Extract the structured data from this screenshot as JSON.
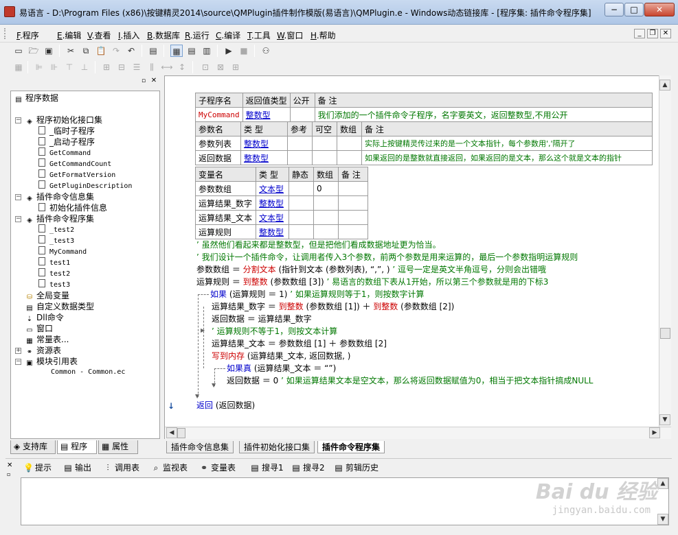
{
  "window": {
    "title": "易语言 - D:\\Program Files (x86)\\按键精灵2014\\source\\QMPlugin插件制作模版(易语言)\\QMPlugin.e - Windows动态链接库 - [程序集: 插件命令程序集]",
    "min": "−",
    "max": "□",
    "close": "✕"
  },
  "menu": [
    {
      "key": "F",
      "label": ".程序"
    },
    {
      "key": "E",
      "label": ".编辑"
    },
    {
      "key": "V",
      "label": ".查看"
    },
    {
      "key": "I",
      "label": ".插入"
    },
    {
      "key": "B",
      "label": ".数据库"
    },
    {
      "key": "R",
      "label": ".运行"
    },
    {
      "key": "C",
      "label": ".编译"
    },
    {
      "key": "T",
      "label": ".工具"
    },
    {
      "key": "W",
      "label": ".窗口"
    },
    {
      "key": "H",
      "label": ".帮助"
    }
  ],
  "tree": {
    "root": "程序数据",
    "g1": "程序初始化接口集",
    "g1_items": [
      "_临时子程序",
      "_启动子程序",
      "GetCommand",
      "GetCommandCount",
      "GetFormatVersion",
      "GetPluginDescription"
    ],
    "g2": "插件命令信息集",
    "g2_items": [
      "初始化插件信息"
    ],
    "g3": "插件命令程序集",
    "g3_items": [
      "_test2",
      "_test3",
      "MyCommand",
      "test1",
      "test2",
      "test3"
    ],
    "others": [
      "全局变量",
      "自定义数据类型",
      "Dll命令",
      "窗口",
      "常量表...",
      "资源表",
      "模块引用表"
    ],
    "module": "Common - Common.ec"
  },
  "left_tabs": [
    "支持库",
    "程序",
    "属性"
  ],
  "sub_table": {
    "headers": [
      "子程序名",
      "返回值类型",
      "公开",
      "备 注"
    ],
    "row": {
      "name": "MyCommand",
      "type": "整数型",
      "public": "",
      "note": "我们添加的一个插件命令子程序，名字要英文，返回整数型,不用公开"
    }
  },
  "param_table": {
    "headers": [
      "参数名",
      "类 型",
      "参考",
      "可空",
      "数组",
      "备 注"
    ],
    "rows": [
      {
        "name": "参数列表",
        "type": "整数型",
        "note": "实际上按键精灵传过来的是一个文本指针，每个参数用','隔开了"
      },
      {
        "name": "返回数据",
        "type": "整数型",
        "note": "如果返回的是整数就直接返回，如果返回的是文本，那么这个就是文本的指针"
      }
    ]
  },
  "var_table": {
    "headers": [
      "变量名",
      "类 型",
      "静态",
      "数组",
      "备 注"
    ],
    "rows": [
      {
        "name": "参数数组",
        "type": "文本型",
        "arr": "0"
      },
      {
        "name": "运算结果_数字",
        "type": "整数型",
        "arr": ""
      },
      {
        "name": "运算结果_文本",
        "type": "文本型",
        "arr": ""
      },
      {
        "name": "运算规则",
        "type": "整数型",
        "arr": ""
      }
    ]
  },
  "code": {
    "c1": "’ 虽然他们看起来都是整数型，但是把他们看成数据地址更为恰当。",
    "c2": "’ 我们设计一个插件命令，让调用者传入3个参数，前两个参数是用来运算的，最后一个参数指明运算规则",
    "l3_a": "参数数组 ＝ ",
    "l3_fn": "分割文本",
    "l3_b": " (指针到文本 (参数列表), “,”, )",
    "l3_c": " ’ 逗号一定是英文半角逗号，分则会出错哦",
    "l4_a": "运算规则 ＝ ",
    "l4_fn": "到整数",
    "l4_b": " (参数数组 [3])",
    "l4_c": " ’ 易语言的数组下表从1开始，所以第三个参数就是用的下标3",
    "l5_kw": "如果",
    "l5_b": " (运算规则 ＝ 1)",
    "l5_c": " ’ 如果运算规则等于1，则按数字计算",
    "l6_a": "运算结果_数字 ＝ ",
    "l6_fn1": "到整数",
    "l6_b": " (参数数组 [1]) ＋ ",
    "l6_fn2": "到整数",
    "l6_c": " (参数数组 [2])",
    "l7": "返回数据 ＝ 运算结果_数字",
    "l8": "’ 运算规则不等于1，则按文本计算",
    "l9": "运算结果_文本 ＝ 参数数组 [1] ＋ 参数数组 [2]",
    "l10_fn": "写到内存",
    "l10_b": " (运算结果_文本, 返回数据, )",
    "l11_kw": "如果真",
    "l11_b": " (运算结果_文本 ＝ “”)",
    "l12_a": "返回数据 ＝ 0",
    "l12_c": " ’ 如果运算结果文本是空文本，那么将返回数据赋值为0，相当于把文本指针搞成NULL",
    "l13_kw": "返回",
    "l13_b": " (返回数据)"
  },
  "bottom_tabs": [
    "插件命令信息集",
    "插件初始化接口集",
    "插件命令程序集"
  ],
  "output_tabs": [
    "提示",
    "输出",
    "调用表",
    "监视表",
    "变量表",
    "搜寻1",
    "搜寻2",
    "剪辑历史"
  ],
  "watermark": {
    "brand": "Bai du 经验",
    "url": "jingyan.baidu.com"
  }
}
